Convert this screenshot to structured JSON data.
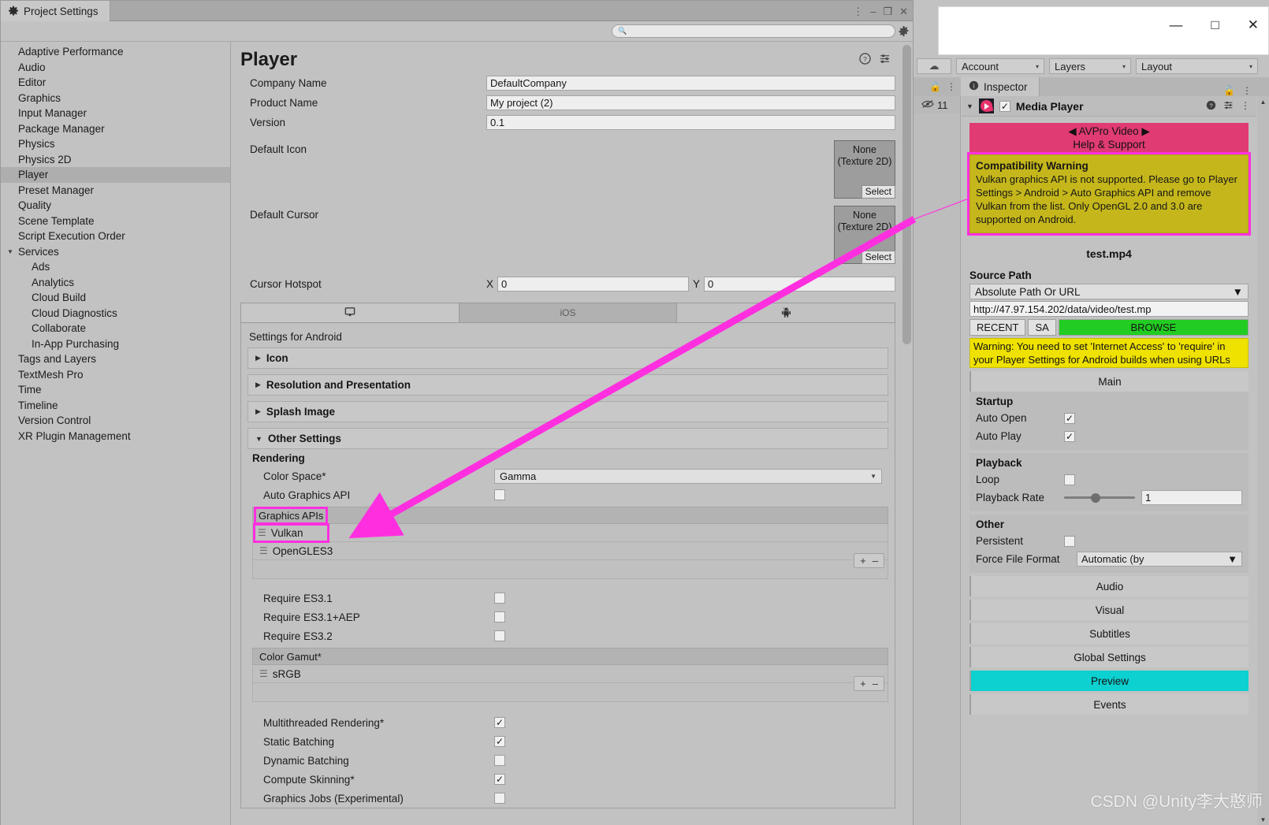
{
  "project_settings_window": {
    "tab_title": "Project Settings",
    "tab_icon": "gear-icon",
    "window_controls": {
      "menu": "⋮",
      "minimize": "–",
      "maximize": "❐",
      "close": "✕"
    },
    "search": {
      "placeholder": "",
      "value": "",
      "icon": "search-icon"
    },
    "sidebar": {
      "items": [
        {
          "label": "Adaptive Performance",
          "selected": false,
          "child": false
        },
        {
          "label": "Audio",
          "selected": false,
          "child": false
        },
        {
          "label": "Editor",
          "selected": false,
          "child": false
        },
        {
          "label": "Graphics",
          "selected": false,
          "child": false
        },
        {
          "label": "Input Manager",
          "selected": false,
          "child": false
        },
        {
          "label": "Package Manager",
          "selected": false,
          "child": false
        },
        {
          "label": "Physics",
          "selected": false,
          "child": false
        },
        {
          "label": "Physics 2D",
          "selected": false,
          "child": false
        },
        {
          "label": "Player",
          "selected": true,
          "child": false
        },
        {
          "label": "Preset Manager",
          "selected": false,
          "child": false
        },
        {
          "label": "Quality",
          "selected": false,
          "child": false
        },
        {
          "label": "Scene Template",
          "selected": false,
          "child": false
        },
        {
          "label": "Script Execution Order",
          "selected": false,
          "child": false
        },
        {
          "label": "Services",
          "selected": false,
          "child": false,
          "expanded": true
        },
        {
          "label": "Ads",
          "selected": false,
          "child": true
        },
        {
          "label": "Analytics",
          "selected": false,
          "child": true
        },
        {
          "label": "Cloud Build",
          "selected": false,
          "child": true
        },
        {
          "label": "Cloud Diagnostics",
          "selected": false,
          "child": true
        },
        {
          "label": "Collaborate",
          "selected": false,
          "child": true
        },
        {
          "label": "In-App Purchasing",
          "selected": false,
          "child": true
        },
        {
          "label": "Tags and Layers",
          "selected": false,
          "child": false
        },
        {
          "label": "TextMesh Pro",
          "selected": false,
          "child": false
        },
        {
          "label": "Time",
          "selected": false,
          "child": false
        },
        {
          "label": "Timeline",
          "selected": false,
          "child": false
        },
        {
          "label": "Version Control",
          "selected": false,
          "child": false
        },
        {
          "label": "XR Plugin Management",
          "selected": false,
          "child": false
        }
      ]
    },
    "player": {
      "title": "Player",
      "header_icons": [
        "help-icon",
        "preset-icon"
      ],
      "fields": [
        {
          "label": "Company Name",
          "value": "DefaultCompany"
        },
        {
          "label": "Product Name",
          "value": "My project (2)"
        },
        {
          "label": "Version",
          "value": "0.1"
        }
      ],
      "default_icon": {
        "label": "Default Icon",
        "value": "None",
        "type": "(Texture 2D)",
        "button": "Select"
      },
      "default_cursor": {
        "label": "Default Cursor",
        "value": "None",
        "type": "(Texture 2D)",
        "button": "Select"
      },
      "cursor_hotspot": {
        "label": "Cursor Hotspot",
        "x_label": "X",
        "x_value": "0",
        "y_label": "Y",
        "y_value": "0"
      },
      "platform_tabs": [
        {
          "icon": "desktop-icon",
          "label": "",
          "active": true
        },
        {
          "icon": "ios-icon",
          "label": "iOS",
          "active": false
        },
        {
          "icon": "android-icon",
          "label": "",
          "active": false,
          "selected": true
        }
      ],
      "settings_for": "Settings for Android",
      "foldouts": [
        {
          "label": "Icon",
          "expanded": false
        },
        {
          "label": "Resolution and Presentation",
          "expanded": false
        },
        {
          "label": "Splash Image",
          "expanded": false
        },
        {
          "label": "Other Settings",
          "expanded": true
        }
      ],
      "rendering": {
        "heading": "Rendering",
        "color_space": {
          "label": "Color Space*",
          "value": "Gamma"
        },
        "auto_graphics_api": {
          "label": "Auto Graphics API",
          "checked": false
        },
        "graphics_apis": {
          "header": "Graphics APIs",
          "items": [
            "Vulkan",
            "OpenGLES3"
          ],
          "highlighted_item": "Vulkan",
          "add": "+",
          "remove": "–"
        },
        "require_flags": [
          {
            "label": "Require ES3.1",
            "checked": false
          },
          {
            "label": "Require ES3.1+AEP",
            "checked": false
          },
          {
            "label": "Require ES3.2",
            "checked": false
          }
        ],
        "color_gamut": {
          "header": "Color Gamut*",
          "items": [
            "sRGB"
          ],
          "add": "+",
          "remove": "–"
        },
        "toggles": [
          {
            "label": "Multithreaded Rendering*",
            "checked": true
          },
          {
            "label": "Static Batching",
            "checked": true
          },
          {
            "label": "Dynamic Batching",
            "checked": false
          },
          {
            "label": "Compute Skinning*",
            "checked": true
          },
          {
            "label": "Graphics Jobs (Experimental)",
            "checked": false
          }
        ]
      }
    }
  },
  "overlay_window": {
    "controls": {
      "minimize": "—",
      "maximize": "□",
      "close": "✕"
    }
  },
  "unity_editor": {
    "toolbar": {
      "cloud_icon": "cloud-icon",
      "dropdowns": [
        {
          "label": "Account"
        },
        {
          "label": "Layers"
        },
        {
          "label": "Layout"
        }
      ],
      "dd_arrow": "▾"
    },
    "hierarchy": {
      "lock_icon": "lock-icon",
      "menu_icon": "kebab-icon",
      "eye_icon": "eye-off-icon",
      "count": "11"
    },
    "inspector": {
      "tab_label": "Inspector",
      "tab_icon": "info-icon",
      "lock_icon": "lock-icon",
      "menu_icon": "kebab-icon",
      "component": {
        "name": "Media Player",
        "icon": "media-player-icon",
        "enabled": true,
        "icons": [
          "help-icon",
          "preset-icon",
          "kebab-icon"
        ]
      },
      "avpro_banner": {
        "line1": "◀ AVPro Video ▶",
        "line2": "Help & Support"
      },
      "compatibility_warning": {
        "title": "Compatibility Warning",
        "body": "Vulkan graphics API is not supported. Please go to Player Settings > Android > Auto Graphics API and remove Vulkan from the list.  Only OpenGL 2.0 and 3.0 are supported on Android.",
        "highlight_color": "#ff2fe0",
        "background_color": "#c5b71b"
      },
      "file_name": "test.mp4",
      "source_path": {
        "label": "Source Path",
        "mode": "Absolute Path Or URL",
        "url": "http://47.97.154.202/data/video/test.mp",
        "buttons": [
          {
            "label": "RECENT",
            "style": "default"
          },
          {
            "label": "SA",
            "style": "default"
          },
          {
            "label": "BROWSE",
            "style": "green"
          }
        ],
        "warning": "Warning: You need to set 'Internet Access' to 'require' in your Player Settings for Android builds when using URLs"
      },
      "sections": [
        {
          "label": "Main",
          "active": false
        },
        {
          "label": "Audio",
          "active": false
        },
        {
          "label": "Visual",
          "active": false
        },
        {
          "label": "Subtitles",
          "active": false
        },
        {
          "label": "Global Settings",
          "active": false
        },
        {
          "label": "Preview",
          "active": true
        },
        {
          "label": "Events",
          "active": false
        }
      ],
      "main_groups": [
        {
          "title": "Startup",
          "rows": [
            {
              "label": "Auto Open",
              "type": "checkbox",
              "checked": true
            },
            {
              "label": "Auto Play",
              "type": "checkbox",
              "checked": true
            }
          ]
        },
        {
          "title": "Playback",
          "rows": [
            {
              "label": "Loop",
              "type": "checkbox",
              "checked": false
            },
            {
              "label": "Playback Rate",
              "type": "slider",
              "value": "1"
            }
          ]
        },
        {
          "title": "Other",
          "rows": [
            {
              "label": "Persistent",
              "type": "checkbox",
              "checked": false
            },
            {
              "label": "Force File Format",
              "type": "dropdown",
              "value": "Automatic (by "
            }
          ]
        }
      ]
    }
  },
  "annotation": {
    "color": "#ff2fe0",
    "type": "arrow",
    "from": "compatibility-warning",
    "to": "graphics-apis-vulkan"
  },
  "watermark": "CSDN @Unity李大憨师"
}
